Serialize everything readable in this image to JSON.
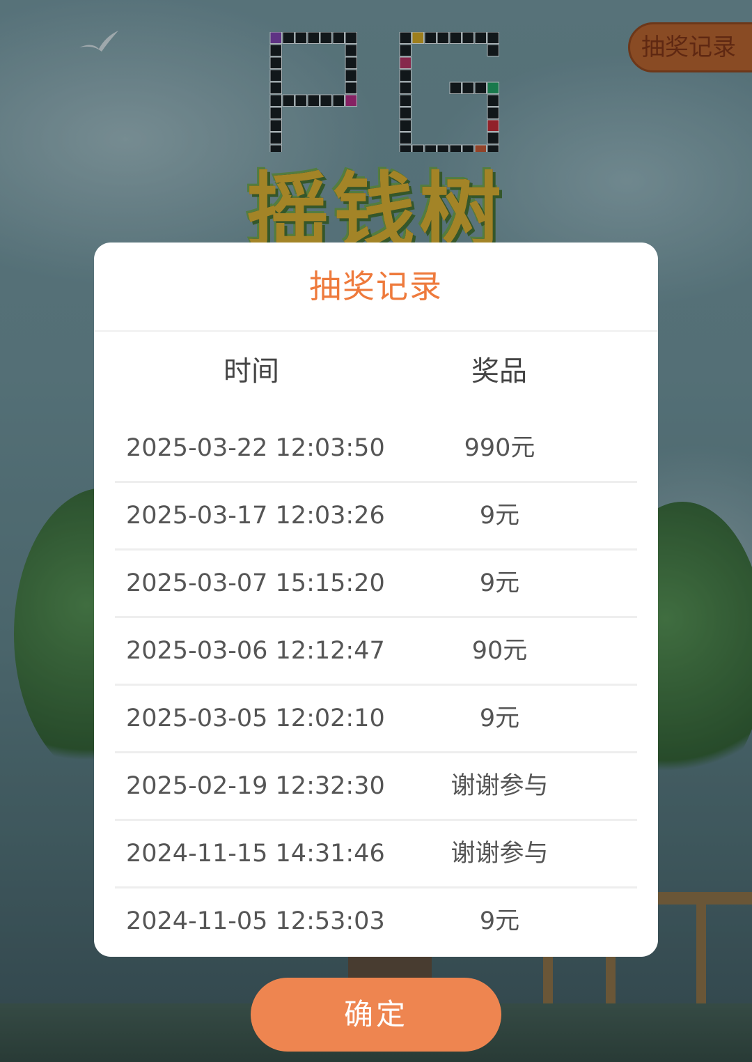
{
  "background": {
    "logo_text": "PG",
    "game_title": "摇钱树",
    "record_button_label": "抽奖记录"
  },
  "modal": {
    "title": "抽奖记录",
    "columns": [
      "时间",
      "奖品"
    ],
    "rows": [
      {
        "time": "2025-03-22 12:03:50",
        "prize": "990元"
      },
      {
        "time": "2025-03-17 12:03:26",
        "prize": "9元"
      },
      {
        "time": "2025-03-07 15:15:20",
        "prize": "9元"
      },
      {
        "time": "2025-03-06 12:12:47",
        "prize": "90元"
      },
      {
        "time": "2025-03-05 12:02:10",
        "prize": "9元"
      },
      {
        "time": "2025-02-19 12:32:30",
        "prize": "谢谢参与"
      },
      {
        "time": "2024-11-15 14:31:46",
        "prize": "谢谢参与"
      },
      {
        "time": "2024-11-05 12:53:03",
        "prize": "9元"
      }
    ],
    "confirm_label": "确定"
  },
  "colors": {
    "accent": "#ee7a3c",
    "button": "#ee8550",
    "pill": "#b55a23"
  }
}
